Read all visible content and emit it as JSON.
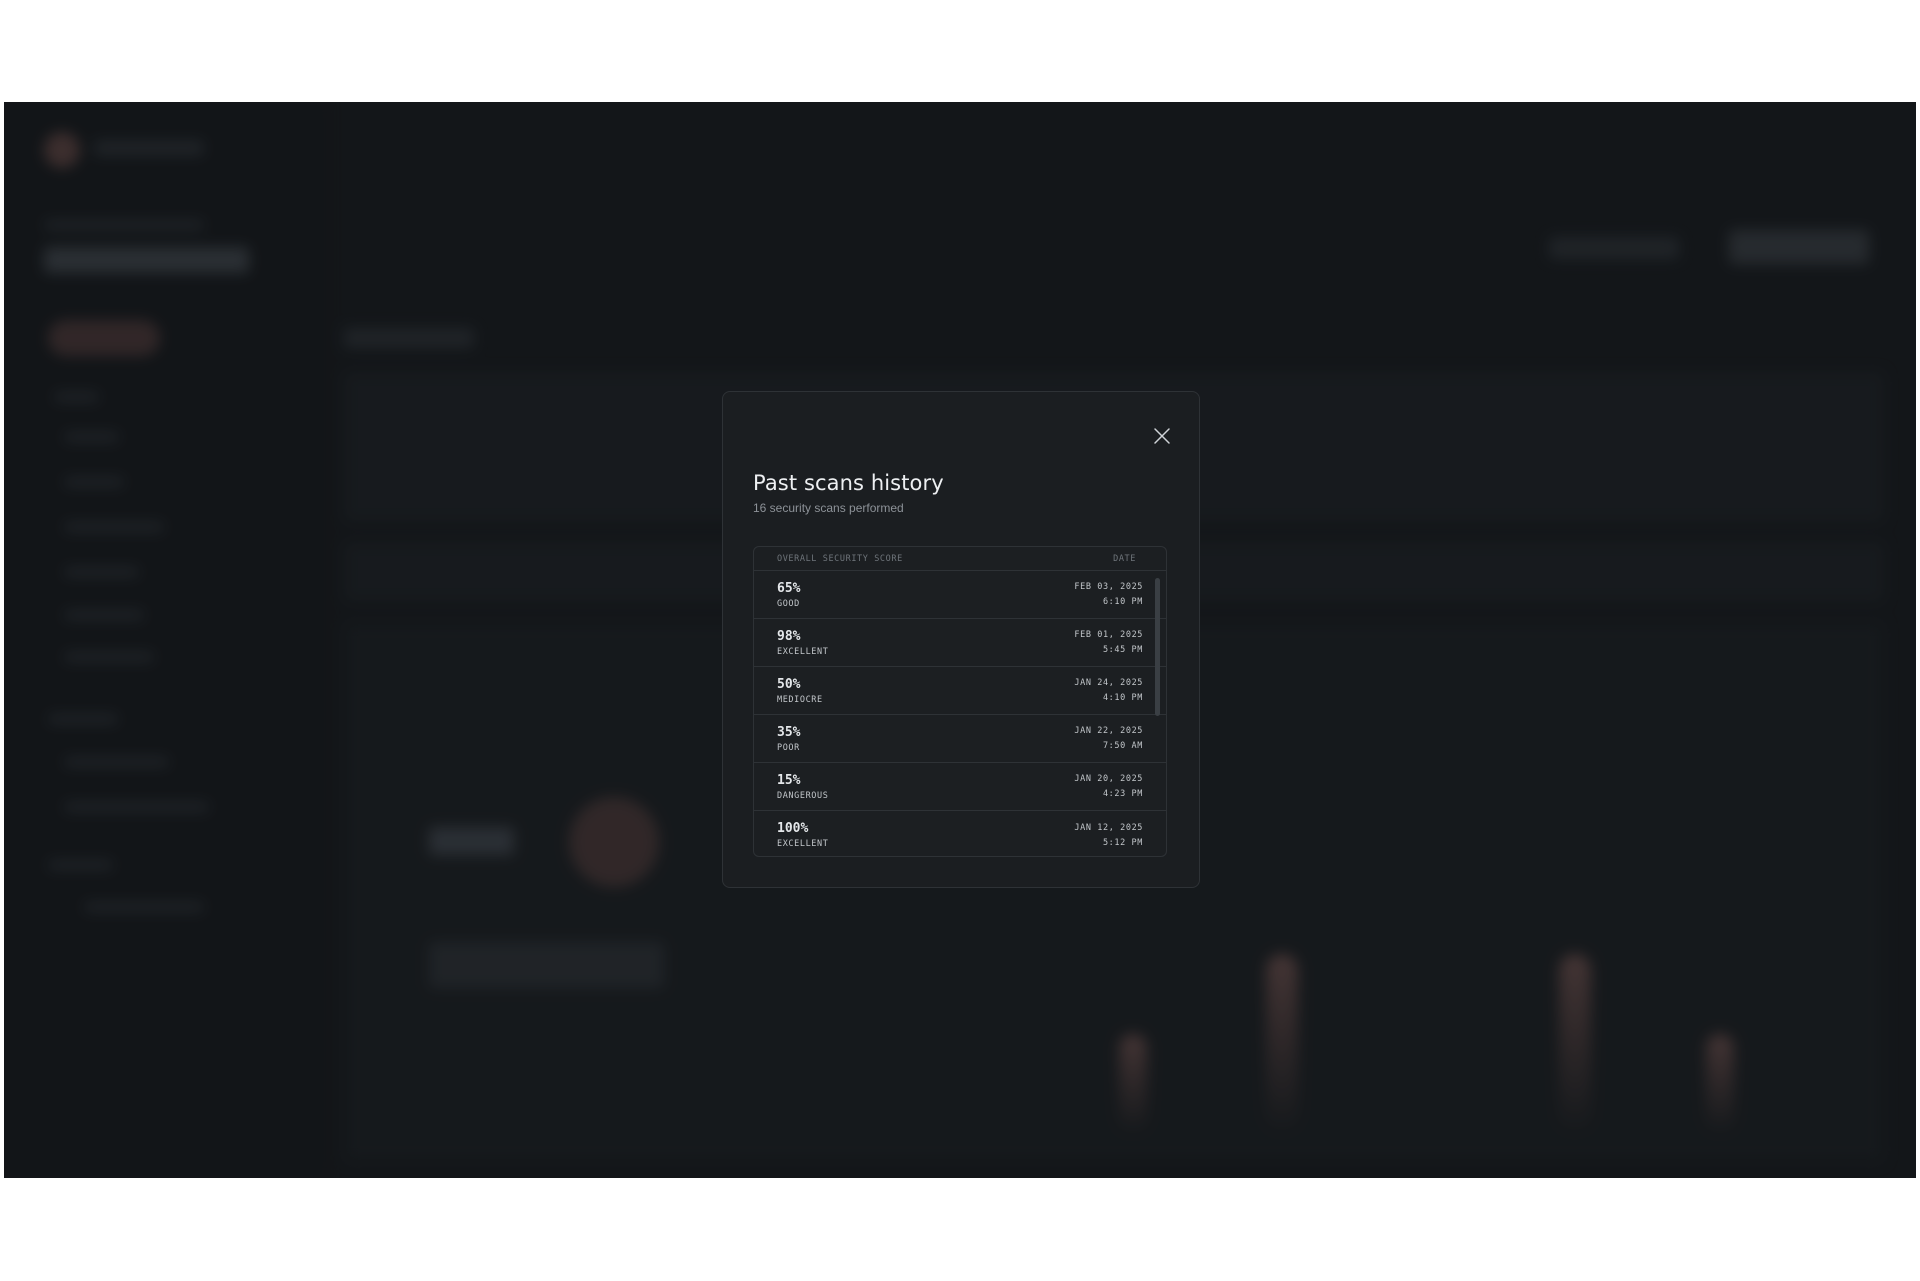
{
  "modal": {
    "title": "Past scans history",
    "subtitle": "16 security scans performed",
    "close_icon": "close-icon"
  },
  "table": {
    "headers": {
      "score": "OVERALL SECURITY SCORE",
      "date": "DATE"
    },
    "rows": [
      {
        "score": "65%",
        "rating": "GOOD",
        "date": "FEB 03, 2025",
        "time": "6:10 PM"
      },
      {
        "score": "98%",
        "rating": "EXCELLENT",
        "date": "FEB 01, 2025",
        "time": "5:45 PM"
      },
      {
        "score": "50%",
        "rating": "MEDIOCRE",
        "date": "JAN 24, 2025",
        "time": "4:10 PM"
      },
      {
        "score": "35%",
        "rating": "POOR",
        "date": "JAN 22, 2025",
        "time": "7:50 AM"
      },
      {
        "score": "15%",
        "rating": "DANGEROUS",
        "date": "JAN 20, 2025",
        "time": "4:23 PM"
      },
      {
        "score": "100%",
        "rating": "EXCELLENT",
        "date": "JAN 12, 2025",
        "time": "5:12 PM"
      }
    ]
  },
  "colors": {
    "background": "#181b1e",
    "modal_bg": "#1b1e21",
    "border": "#2e3236",
    "accent_blur": "#8a5e58"
  }
}
